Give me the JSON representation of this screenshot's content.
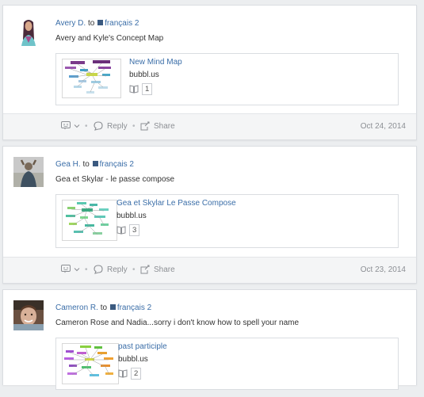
{
  "posts": [
    {
      "author": "Avery D.",
      "to": "to",
      "group": "français 2",
      "text": "Avery and Kyle's Concept Map",
      "attachment": {
        "title": "New Mind Map",
        "source": "bubbl.us",
        "count": "1"
      },
      "reply_label": "Reply",
      "share_label": "Share",
      "date": "Oct 24, 2014"
    },
    {
      "author": "Gea H.",
      "to": "to",
      "group": "français 2",
      "text": "Gea et Skylar - le passe compose",
      "attachment": {
        "title": "Gea et Skylar Le Passe Compose",
        "source": "bubbl.us",
        "count": "3"
      },
      "reply_label": "Reply",
      "share_label": "Share",
      "date": "Oct 23, 2014"
    },
    {
      "author": "Cameron R.",
      "to": "to",
      "group": "français 2",
      "text": "Cameron Rose and Nadia...sorry i don't know how to spell your name",
      "attachment": {
        "title": "past participle",
        "source": "bubbl.us",
        "count": "2"
      }
    }
  ],
  "icons": {
    "reaction": "reaction-icon",
    "chevron": "chevron-down-icon",
    "reply": "reply-bubble-icon",
    "share": "share-icon",
    "book": "book-icon",
    "group": "group-square-icon"
  },
  "colors": {
    "link": "#3b6ea8",
    "group_square": "#3b5a80",
    "footer_bg": "#f4f5f6",
    "page_bg": "#eceef0"
  }
}
